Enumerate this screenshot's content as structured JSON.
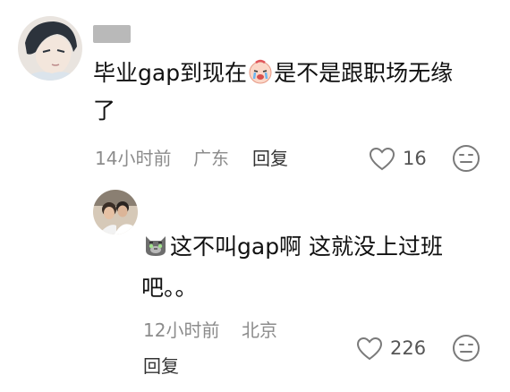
{
  "comment1": {
    "line1_a": "毕业gap到现在",
    "line1_b": "是不是跟职场无缘",
    "line2": "了",
    "time": "14小时前",
    "location": "广东",
    "reply": "回复",
    "likes": "16",
    "avatar": "anime-avatar",
    "emoji": "crying-face-emoji"
  },
  "comment2": {
    "line1": "这不叫gap啊 这就没上过班",
    "line2": "吧。。",
    "time": "12小时前",
    "location": "北京",
    "reply": "回复",
    "likes": "226",
    "avatar": "photo-avatar",
    "emoji": "gray-cat-emoji"
  },
  "colors": {
    "text": "#111111",
    "meta": "#8c8c8c",
    "icon": "#7a7a7a"
  }
}
